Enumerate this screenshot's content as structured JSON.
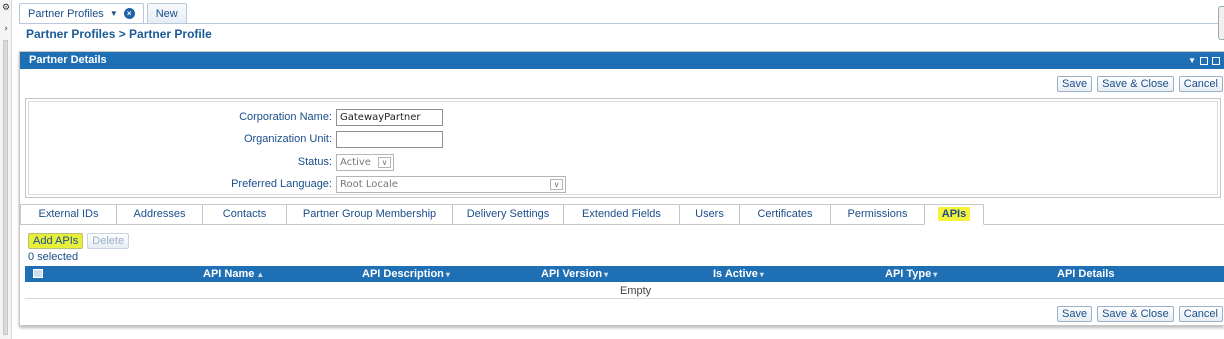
{
  "doc_tabs": [
    {
      "label": "Partner Profiles",
      "active": true
    },
    {
      "label": "New",
      "active": false
    }
  ],
  "breadcrumb": "Partner Profiles > Partner Profile",
  "panel": {
    "title": "Partner Details"
  },
  "actions": {
    "save": "Save",
    "save_close": "Save & Close",
    "cancel": "Cancel"
  },
  "form": {
    "corporation_name": {
      "label": "Corporation Name:",
      "value": "GatewayPartner"
    },
    "organization_unit": {
      "label": "Organization Unit:",
      "value": ""
    },
    "status": {
      "label": "Status:",
      "value": "Active"
    },
    "preferred_language": {
      "label": "Preferred Language:",
      "value": "Root Locale"
    }
  },
  "sub_tabs": [
    {
      "label": "External IDs"
    },
    {
      "label": "Addresses"
    },
    {
      "label": "Contacts"
    },
    {
      "label": "Partner Group Membership"
    },
    {
      "label": "Delivery Settings"
    },
    {
      "label": "Extended Fields"
    },
    {
      "label": "Users"
    },
    {
      "label": "Certificates"
    },
    {
      "label": "Permissions"
    },
    {
      "label": "APIs",
      "active": true,
      "highlighted": true
    }
  ],
  "api_toolbar": {
    "add_label": "Add APIs",
    "delete_label": "Delete",
    "selected_count": "0 selected"
  },
  "grid": {
    "columns": [
      {
        "label": "API Name",
        "sort": "▲"
      },
      {
        "label": "API Description",
        "sort": "▾"
      },
      {
        "label": "API Version",
        "sort": "▾"
      },
      {
        "label": "Is Active",
        "sort": "▾"
      },
      {
        "label": "API Type",
        "sort": "▾"
      },
      {
        "label": "API Details",
        "sort": ""
      }
    ],
    "empty_text": "Empty"
  },
  "colors": {
    "header_blue": "#1f6fb4",
    "link_blue": "#1a4e8a",
    "highlight_yellow": "#f4f23a"
  }
}
